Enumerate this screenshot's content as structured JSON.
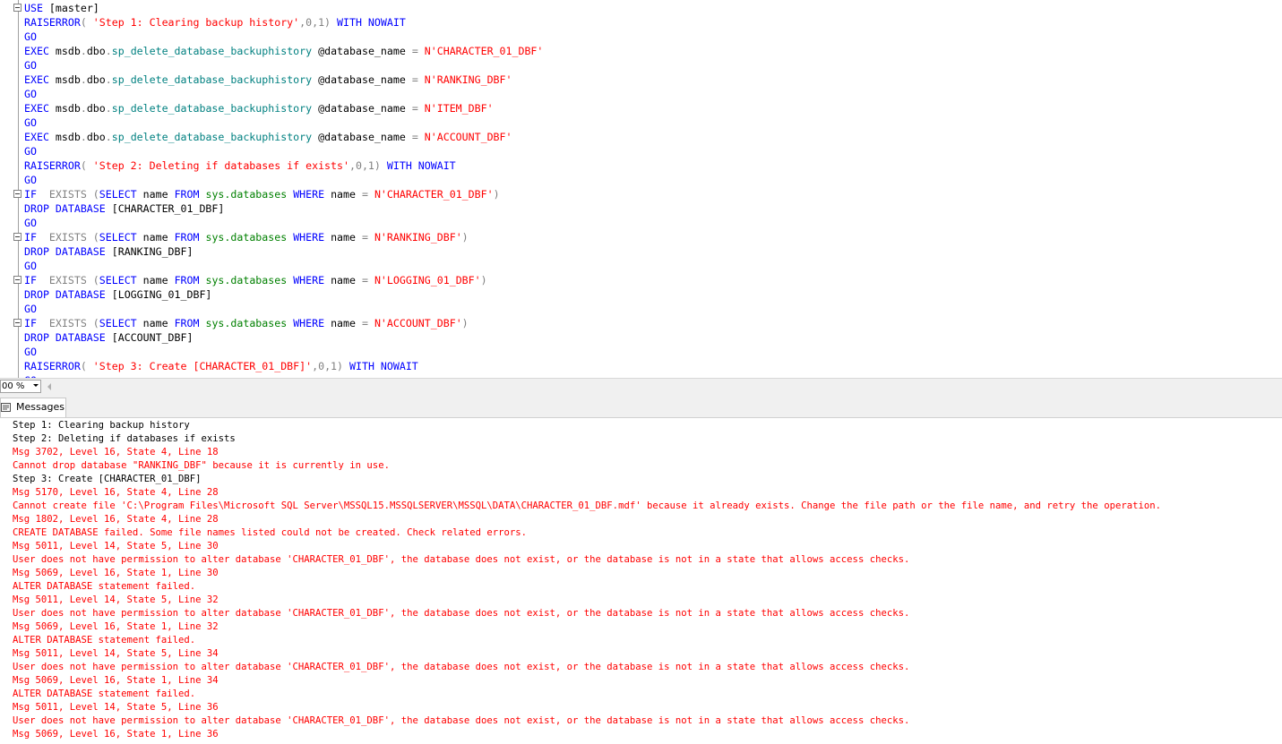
{
  "editor": {
    "lines": [
      {
        "fold": true,
        "tokens": [
          {
            "t": "USE",
            "c": "kw"
          },
          {
            "t": " [master]",
            "c": "plain"
          }
        ]
      },
      {
        "fold": false,
        "tokens": [
          {
            "t": "RAISERROR",
            "c": "kw"
          },
          {
            "t": "( ",
            "c": "gray"
          },
          {
            "t": "'Step 1: Clearing backup history'",
            "c": "str"
          },
          {
            "t": ",0,1) ",
            "c": "gray"
          },
          {
            "t": "WITH NOWAIT",
            "c": "kw"
          }
        ]
      },
      {
        "fold": false,
        "tokens": [
          {
            "t": "GO",
            "c": "kw"
          }
        ]
      },
      {
        "fold": false,
        "tokens": [
          {
            "t": "EXEC",
            "c": "kw"
          },
          {
            "t": " msdb",
            "c": "plain"
          },
          {
            "t": ".",
            "c": "gray"
          },
          {
            "t": "dbo",
            "c": "plain"
          },
          {
            "t": ".",
            "c": "gray"
          },
          {
            "t": "sp_delete_database_backuphistory",
            "c": "teal"
          },
          {
            "t": " @database_name ",
            "c": "plain"
          },
          {
            "t": "=",
            "c": "gray"
          },
          {
            "t": " N'CHARACTER_01_DBF'",
            "c": "str"
          }
        ]
      },
      {
        "fold": false,
        "tokens": [
          {
            "t": "GO",
            "c": "kw"
          }
        ]
      },
      {
        "fold": false,
        "tokens": [
          {
            "t": "EXEC",
            "c": "kw"
          },
          {
            "t": " msdb",
            "c": "plain"
          },
          {
            "t": ".",
            "c": "gray"
          },
          {
            "t": "dbo",
            "c": "plain"
          },
          {
            "t": ".",
            "c": "gray"
          },
          {
            "t": "sp_delete_database_backuphistory",
            "c": "teal"
          },
          {
            "t": " @database_name ",
            "c": "plain"
          },
          {
            "t": "=",
            "c": "gray"
          },
          {
            "t": " N'RANKING_DBF'",
            "c": "str"
          }
        ]
      },
      {
        "fold": false,
        "tokens": [
          {
            "t": "GO",
            "c": "kw"
          }
        ]
      },
      {
        "fold": false,
        "tokens": [
          {
            "t": "EXEC",
            "c": "kw"
          },
          {
            "t": " msdb",
            "c": "plain"
          },
          {
            "t": ".",
            "c": "gray"
          },
          {
            "t": "dbo",
            "c": "plain"
          },
          {
            "t": ".",
            "c": "gray"
          },
          {
            "t": "sp_delete_database_backuphistory",
            "c": "teal"
          },
          {
            "t": " @database_name ",
            "c": "plain"
          },
          {
            "t": "=",
            "c": "gray"
          },
          {
            "t": " N'ITEM_DBF'",
            "c": "str"
          }
        ]
      },
      {
        "fold": false,
        "tokens": [
          {
            "t": "GO",
            "c": "kw"
          }
        ]
      },
      {
        "fold": false,
        "tokens": [
          {
            "t": "EXEC",
            "c": "kw"
          },
          {
            "t": " msdb",
            "c": "plain"
          },
          {
            "t": ".",
            "c": "gray"
          },
          {
            "t": "dbo",
            "c": "plain"
          },
          {
            "t": ".",
            "c": "gray"
          },
          {
            "t": "sp_delete_database_backuphistory",
            "c": "teal"
          },
          {
            "t": " @database_name ",
            "c": "plain"
          },
          {
            "t": "=",
            "c": "gray"
          },
          {
            "t": " N'ACCOUNT_DBF'",
            "c": "str"
          }
        ]
      },
      {
        "fold": false,
        "tokens": [
          {
            "t": "GO",
            "c": "kw"
          }
        ]
      },
      {
        "fold": false,
        "tokens": [
          {
            "t": "RAISERROR",
            "c": "kw"
          },
          {
            "t": "( ",
            "c": "gray"
          },
          {
            "t": "'Step 2: Deleting if databases if exists'",
            "c": "str"
          },
          {
            "t": ",0,1) ",
            "c": "gray"
          },
          {
            "t": "WITH NOWAIT",
            "c": "kw"
          }
        ]
      },
      {
        "fold": false,
        "tokens": [
          {
            "t": "GO",
            "c": "kw"
          }
        ]
      },
      {
        "fold": true,
        "tokens": [
          {
            "t": "IF",
            "c": "kw"
          },
          {
            "t": "  EXISTS (",
            "c": "gray"
          },
          {
            "t": "SELECT",
            "c": "kw"
          },
          {
            "t": " name ",
            "c": "plain"
          },
          {
            "t": "FROM",
            "c": "kw"
          },
          {
            "t": " sys.databases ",
            "c": "sys"
          },
          {
            "t": "WHERE",
            "c": "kw"
          },
          {
            "t": " name ",
            "c": "plain"
          },
          {
            "t": "=",
            "c": "gray"
          },
          {
            "t": " N'CHARACTER_01_DBF'",
            "c": "str"
          },
          {
            "t": ")",
            "c": "gray"
          }
        ]
      },
      {
        "fold": false,
        "tokens": [
          {
            "t": "DROP DATABASE",
            "c": "kw"
          },
          {
            "t": " [CHARACTER_01_DBF]",
            "c": "plain"
          }
        ]
      },
      {
        "fold": false,
        "tokens": [
          {
            "t": "GO",
            "c": "kw"
          }
        ]
      },
      {
        "fold": true,
        "tokens": [
          {
            "t": "IF",
            "c": "kw"
          },
          {
            "t": "  EXISTS (",
            "c": "gray"
          },
          {
            "t": "SELECT",
            "c": "kw"
          },
          {
            "t": " name ",
            "c": "plain"
          },
          {
            "t": "FROM",
            "c": "kw"
          },
          {
            "t": " sys.databases ",
            "c": "sys"
          },
          {
            "t": "WHERE",
            "c": "kw"
          },
          {
            "t": " name ",
            "c": "plain"
          },
          {
            "t": "=",
            "c": "gray"
          },
          {
            "t": " N'RANKING_DBF'",
            "c": "str"
          },
          {
            "t": ")",
            "c": "gray"
          }
        ]
      },
      {
        "fold": false,
        "tokens": [
          {
            "t": "DROP DATABASE",
            "c": "kw"
          },
          {
            "t": " [RANKING_DBF]",
            "c": "plain"
          }
        ]
      },
      {
        "fold": false,
        "tokens": [
          {
            "t": "GO",
            "c": "kw"
          }
        ]
      },
      {
        "fold": true,
        "tokens": [
          {
            "t": "IF",
            "c": "kw"
          },
          {
            "t": "  EXISTS (",
            "c": "gray"
          },
          {
            "t": "SELECT",
            "c": "kw"
          },
          {
            "t": " name ",
            "c": "plain"
          },
          {
            "t": "FROM",
            "c": "kw"
          },
          {
            "t": " sys.databases ",
            "c": "sys"
          },
          {
            "t": "WHERE",
            "c": "kw"
          },
          {
            "t": " name ",
            "c": "plain"
          },
          {
            "t": "=",
            "c": "gray"
          },
          {
            "t": " N'LOGGING_01_DBF'",
            "c": "str"
          },
          {
            "t": ")",
            "c": "gray"
          }
        ]
      },
      {
        "fold": false,
        "tokens": [
          {
            "t": "DROP DATABASE",
            "c": "kw"
          },
          {
            "t": " [LOGGING_01_DBF]",
            "c": "plain"
          }
        ]
      },
      {
        "fold": false,
        "tokens": [
          {
            "t": "GO",
            "c": "kw"
          }
        ]
      },
      {
        "fold": true,
        "tokens": [
          {
            "t": "IF",
            "c": "kw"
          },
          {
            "t": "  EXISTS (",
            "c": "gray"
          },
          {
            "t": "SELECT",
            "c": "kw"
          },
          {
            "t": " name ",
            "c": "plain"
          },
          {
            "t": "FROM",
            "c": "kw"
          },
          {
            "t": " sys.databases ",
            "c": "sys"
          },
          {
            "t": "WHERE",
            "c": "kw"
          },
          {
            "t": " name ",
            "c": "plain"
          },
          {
            "t": "=",
            "c": "gray"
          },
          {
            "t": " N'ACCOUNT_DBF'",
            "c": "str"
          },
          {
            "t": ")",
            "c": "gray"
          }
        ]
      },
      {
        "fold": false,
        "tokens": [
          {
            "t": "DROP DATABASE",
            "c": "kw"
          },
          {
            "t": " [ACCOUNT_DBF]",
            "c": "plain"
          }
        ]
      },
      {
        "fold": false,
        "tokens": [
          {
            "t": "GO",
            "c": "kw"
          }
        ]
      },
      {
        "fold": false,
        "tokens": [
          {
            "t": "RAISERROR",
            "c": "kw"
          },
          {
            "t": "( ",
            "c": "gray"
          },
          {
            "t": "'Step 3: Create [CHARACTER_01_DBF]'",
            "c": "str"
          },
          {
            "t": ",0,1) ",
            "c": "gray"
          },
          {
            "t": "WITH NOWAIT",
            "c": "kw"
          }
        ]
      },
      {
        "fold": false,
        "tokens": [
          {
            "t": "GO",
            "c": "kw"
          }
        ]
      }
    ]
  },
  "zoom": {
    "value": "00 %"
  },
  "tabs": {
    "messages_label": "Messages"
  },
  "messages": [
    {
      "type": "info",
      "text": "Step 1: Clearing backup history"
    },
    {
      "type": "info",
      "text": "Step 2: Deleting if databases if exists"
    },
    {
      "type": "error",
      "text": "Msg 3702, Level 16, State 4, Line 18"
    },
    {
      "type": "error",
      "text": "Cannot drop database \"RANKING_DBF\" because it is currently in use."
    },
    {
      "type": "info",
      "text": "Step 3: Create [CHARACTER_01_DBF]"
    },
    {
      "type": "error",
      "text": "Msg 5170, Level 16, State 4, Line 28"
    },
    {
      "type": "error",
      "text": "Cannot create file 'C:\\Program Files\\Microsoft SQL Server\\MSSQL15.MSSQLSERVER\\MSSQL\\DATA\\CHARACTER_01_DBF.mdf' because it already exists. Change the file path or the file name, and retry the operation."
    },
    {
      "type": "error",
      "text": "Msg 1802, Level 16, State 4, Line 28"
    },
    {
      "type": "error",
      "text": "CREATE DATABASE failed. Some file names listed could not be created. Check related errors."
    },
    {
      "type": "error",
      "text": "Msg 5011, Level 14, State 5, Line 30"
    },
    {
      "type": "error",
      "text": "User does not have permission to alter database 'CHARACTER_01_DBF', the database does not exist, or the database is not in a state that allows access checks."
    },
    {
      "type": "error",
      "text": "Msg 5069, Level 16, State 1, Line 30"
    },
    {
      "type": "error",
      "text": "ALTER DATABASE statement failed."
    },
    {
      "type": "error",
      "text": "Msg 5011, Level 14, State 5, Line 32"
    },
    {
      "type": "error",
      "text": "User does not have permission to alter database 'CHARACTER_01_DBF', the database does not exist, or the database is not in a state that allows access checks."
    },
    {
      "type": "error",
      "text": "Msg 5069, Level 16, State 1, Line 32"
    },
    {
      "type": "error",
      "text": "ALTER DATABASE statement failed."
    },
    {
      "type": "error",
      "text": "Msg 5011, Level 14, State 5, Line 34"
    },
    {
      "type": "error",
      "text": "User does not have permission to alter database 'CHARACTER_01_DBF', the database does not exist, or the database is not in a state that allows access checks."
    },
    {
      "type": "error",
      "text": "Msg 5069, Level 16, State 1, Line 34"
    },
    {
      "type": "error",
      "text": "ALTER DATABASE statement failed."
    },
    {
      "type": "error",
      "text": "Msg 5011, Level 14, State 5, Line 36"
    },
    {
      "type": "error",
      "text": "User does not have permission to alter database 'CHARACTER_01_DBF', the database does not exist, or the database is not in a state that allows access checks."
    },
    {
      "type": "error",
      "text": "Msg 5069, Level 16, State 1, Line 36"
    }
  ]
}
